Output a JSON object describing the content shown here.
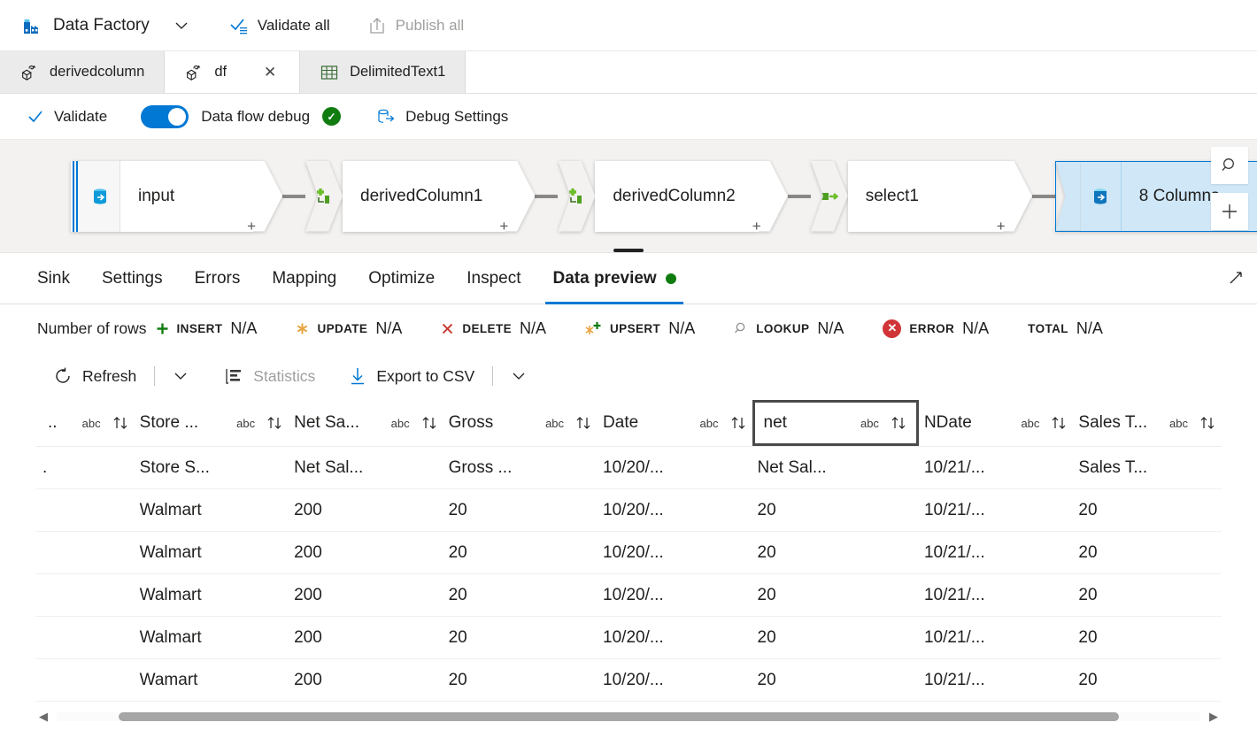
{
  "topbar": {
    "brand_icon": "data-factory-icon",
    "brand": "Data Factory",
    "chevron_icon": "chevron-down-icon",
    "validate_all_icon": "validate-all-icon",
    "validate_all": "Validate all",
    "publish_all_icon": "publish-upload-icon",
    "publish_all": "Publish all"
  },
  "tabs": [
    {
      "label": "derivedcolumn",
      "icon": "dataflow-icon",
      "active": false,
      "closable": false
    },
    {
      "label": "df",
      "icon": "dataflow-icon",
      "active": true,
      "closable": true,
      "close_glyph": "✕"
    },
    {
      "label": "DelimitedText1",
      "icon": "dataset-table-icon",
      "active": false,
      "closable": false
    }
  ],
  "commandbar": {
    "validate_icon": "checkmark-icon",
    "validate": "Validate",
    "debug_toggle_state": "on",
    "debug_toggle_label": "Data flow debug",
    "debug_status_icon": "green-check-icon",
    "debug_settings_icon": "debug-settings-icon",
    "debug_settings": "Debug Settings"
  },
  "canvas": {
    "nodes": [
      {
        "label": "input",
        "type": "source",
        "icon": "source-database-icon",
        "selected": false
      },
      {
        "label": "derivedColumn1",
        "type": "transform",
        "icon": "derived-column-icon",
        "selected": false
      },
      {
        "label": "derivedColumn2",
        "type": "transform",
        "icon": "derived-column-icon",
        "selected": false
      },
      {
        "label": "select1",
        "type": "transform",
        "icon": "select-icon",
        "selected": false
      },
      {
        "label": "8 Columns",
        "type": "sink",
        "icon": "sink-database-icon",
        "selected": true
      }
    ],
    "add_marks": [
      "+",
      "+",
      "+",
      "+"
    ],
    "search_icon": "search-icon",
    "zoom_in_icon": "plus-icon"
  },
  "panel_tabs": [
    {
      "label": "Sink",
      "active": false
    },
    {
      "label": "Settings",
      "active": false
    },
    {
      "label": "Errors",
      "active": false
    },
    {
      "label": "Mapping",
      "active": false
    },
    {
      "label": "Optimize",
      "active": false
    },
    {
      "label": "Inspect",
      "active": false
    },
    {
      "label": "Data preview",
      "active": true,
      "status_dot": "green"
    }
  ],
  "panel_expand_icon": "expand-diagonal-icon",
  "stats": {
    "title": "Number of rows",
    "items": [
      {
        "label": "INSERT",
        "value": "N/A",
        "icon": "plus-green-icon"
      },
      {
        "label": "UPDATE",
        "value": "N/A",
        "icon": "asterisk-orange-icon"
      },
      {
        "label": "DELETE",
        "value": "N/A",
        "icon": "x-red-icon"
      },
      {
        "label": "UPSERT",
        "value": "N/A",
        "icon": "upsert-icon"
      },
      {
        "label": "LOOKUP",
        "value": "N/A",
        "icon": "magnifier-grey-icon"
      },
      {
        "label": "ERROR",
        "value": "N/A",
        "icon": "error-circle-red-icon"
      },
      {
        "label": "TOTAL",
        "value": "N/A",
        "icon": "none"
      }
    ]
  },
  "preview_toolbar": {
    "refresh_icon": "refresh-icon",
    "refresh": "Refresh",
    "refresh_caret_icon": "chevron-down-icon",
    "statistics_icon": "statistics-icon",
    "statistics": "Statistics",
    "statistics_disabled": true,
    "export_icon": "download-arrow-icon",
    "export": "Export to CSV",
    "export_caret_icon": "chevron-down-icon"
  },
  "grid": {
    "type_badge": "abc",
    "sort_icon": "sort-updown-icon",
    "columns": [
      {
        "name": "..",
        "type": "abc",
        "focused": false
      },
      {
        "name": "Store ...",
        "type": "abc",
        "focused": false
      },
      {
        "name": "Net Sa...",
        "type": "abc",
        "focused": false
      },
      {
        "name": "Gross",
        "type": "abc",
        "focused": false
      },
      {
        "name": "Date",
        "type": "abc",
        "focused": false
      },
      {
        "name": "net",
        "type": "abc",
        "focused": true
      },
      {
        "name": "NDate",
        "type": "abc",
        "focused": false
      },
      {
        "name": "Sales T...",
        "type": "abc",
        "focused": false
      }
    ],
    "rows": [
      [
        ".",
        "Store S...",
        "Net Sal...",
        "Gross ...",
        "10/20/...",
        "Net Sal...",
        "10/21/...",
        "Sales T..."
      ],
      [
        "",
        "Walmart",
        "200",
        "20",
        "10/20/...",
        "20",
        "10/21/...",
        "20"
      ],
      [
        "",
        "Walmart",
        "200",
        "20",
        "10/20/...",
        "20",
        "10/21/...",
        "20"
      ],
      [
        "",
        "Walmart",
        "200",
        "20",
        "10/20/...",
        "20",
        "10/21/...",
        "20"
      ],
      [
        "",
        "Walmart",
        "200",
        "20",
        "10/20/...",
        "20",
        "10/21/...",
        "20"
      ],
      [
        "",
        "Wamart",
        "200",
        "20",
        "10/20/...",
        "20",
        "10/21/...",
        "20"
      ]
    ]
  },
  "scrollbar": {
    "left_arrow": "◀",
    "right_arrow": "▶"
  },
  "colors": {
    "accent": "#0078d4",
    "selected_node": "#cfe7f7",
    "success": "#107c10",
    "error": "#d13438",
    "warning": "#ffaa44",
    "canvas_bg": "#f3f2f1"
  }
}
